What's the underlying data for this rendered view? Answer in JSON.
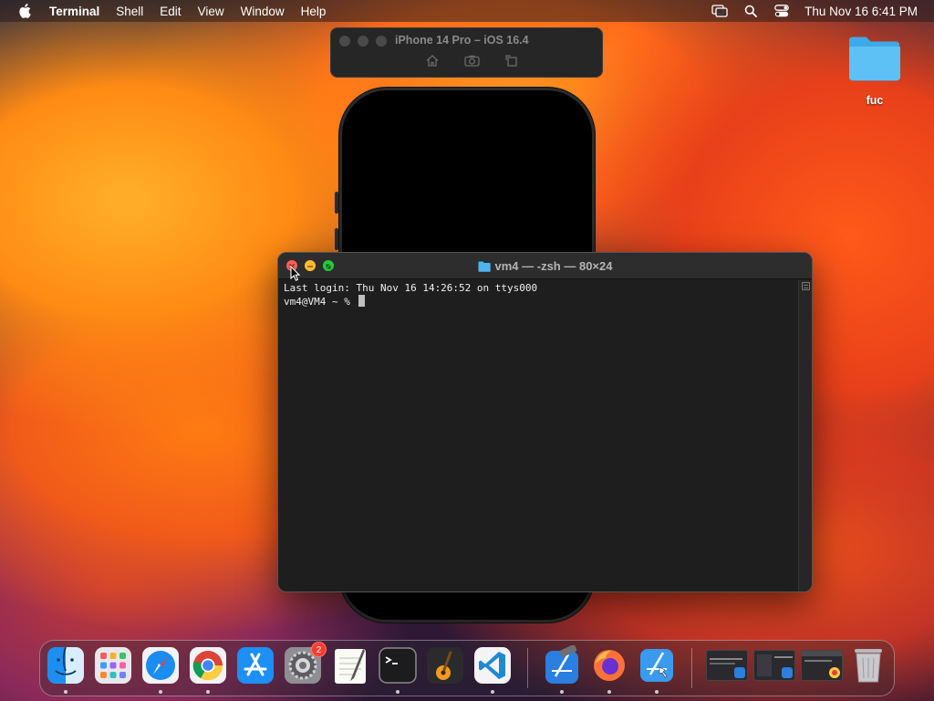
{
  "menubar": {
    "apple_icon": "apple-icon",
    "app_name": "Terminal",
    "items": [
      "Shell",
      "Edit",
      "View",
      "Window",
      "Help"
    ],
    "status_icons": [
      "screen-mirroring-icon",
      "search-icon",
      "control-center-icon"
    ],
    "clock": "Thu Nov 16  6:41 PM"
  },
  "simulator": {
    "title": "iPhone 14 Pro – iOS 16.4",
    "tools": [
      "home-icon",
      "screenshot-icon",
      "rotate-icon"
    ]
  },
  "desktop": {
    "folder_label": "fuc"
  },
  "terminal": {
    "title": "vm4 — -zsh — 80×24",
    "lines": [
      "Last login: Thu Nov 16 14:26:52 on ttys000",
      "vm4@VM4 ~ % "
    ]
  },
  "dock": {
    "apps": [
      {
        "name": "Finder",
        "icon": "finder-icon",
        "running": true
      },
      {
        "name": "Launchpad",
        "icon": "launchpad-icon",
        "running": false
      },
      {
        "name": "Safari",
        "icon": "safari-icon",
        "running": true
      },
      {
        "name": "Google Chrome",
        "icon": "chrome-icon",
        "running": true
      },
      {
        "name": "App Store",
        "icon": "app-store-icon",
        "running": false
      },
      {
        "name": "System Settings",
        "icon": "system-settings-icon",
        "running": false,
        "badge": "2"
      },
      {
        "name": "TextEdit",
        "icon": "textedit-icon",
        "running": false
      },
      {
        "name": "Terminal",
        "icon": "terminal-icon",
        "running": true
      },
      {
        "name": "GarageBand",
        "icon": "garageband-icon",
        "running": false
      },
      {
        "name": "Visual Studio Code",
        "icon": "vscode-icon",
        "running": true
      },
      {
        "name": "Xcode",
        "icon": "xcode-icon",
        "running": true
      },
      {
        "name": "Firefox",
        "icon": "firefox-icon",
        "running": true
      },
      {
        "name": "Simulator",
        "icon": "simulator-icon",
        "running": true
      }
    ],
    "minimized": [
      "minimized-window-1",
      "minimized-window-2",
      "minimized-window-3"
    ],
    "trash_icon": "trash-icon"
  },
  "colors": {
    "terminal_bg": "#1e1e1e",
    "close": "#ff5f57",
    "minimize": "#febc2e",
    "maximize": "#28c840",
    "badge": "#ff3b30"
  }
}
